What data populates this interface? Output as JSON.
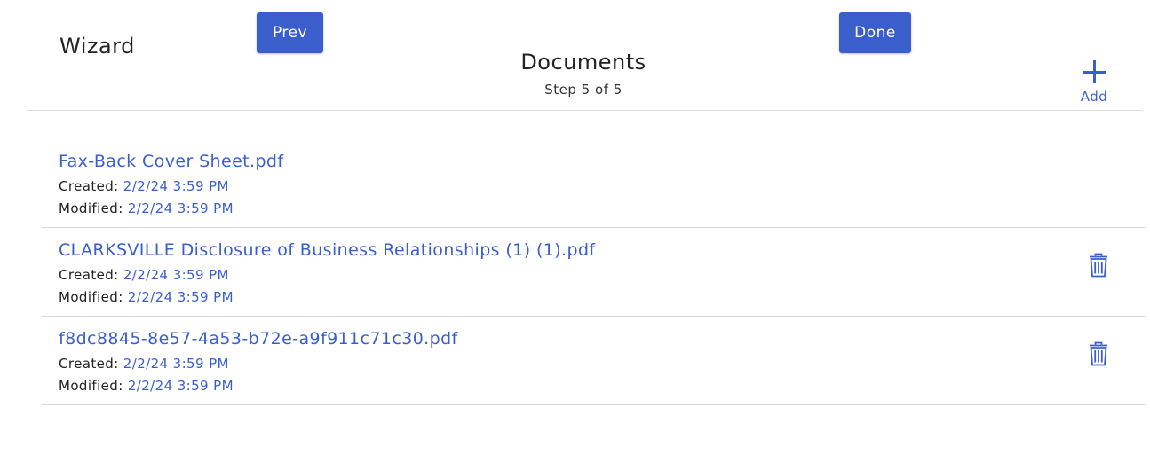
{
  "header": {
    "wizard_label": "Wizard",
    "prev_label": "Prev",
    "done_label": "Done",
    "title": "Documents",
    "step": "Step 5 of 5",
    "add_label": "Add"
  },
  "colors": {
    "accent": "#3a5fcd",
    "divider": "#d8d8d8"
  },
  "documents": [
    {
      "name": "Fax-Back Cover Sheet.pdf",
      "created_label": "Created:",
      "created": "2/2/24 3:59 PM",
      "modified_label": "Modified:",
      "modified": "2/2/24 3:59 PM",
      "deletable": false
    },
    {
      "name": "CLARKSVILLE Disclosure of Business Relationships (1) (1).pdf",
      "created_label": "Created:",
      "created": "2/2/24 3:59 PM",
      "modified_label": "Modified:",
      "modified": "2/2/24 3:59 PM",
      "deletable": true,
      "delete_icon": "trash-icon"
    },
    {
      "name": "f8dc8845-8e57-4a53-b72e-a9f911c71c30.pdf",
      "created_label": "Created:",
      "created": "2/2/24 3:59 PM",
      "modified_label": "Modified:",
      "modified": "2/2/24 3:59 PM",
      "deletable": true,
      "delete_icon": "trash-icon"
    }
  ]
}
